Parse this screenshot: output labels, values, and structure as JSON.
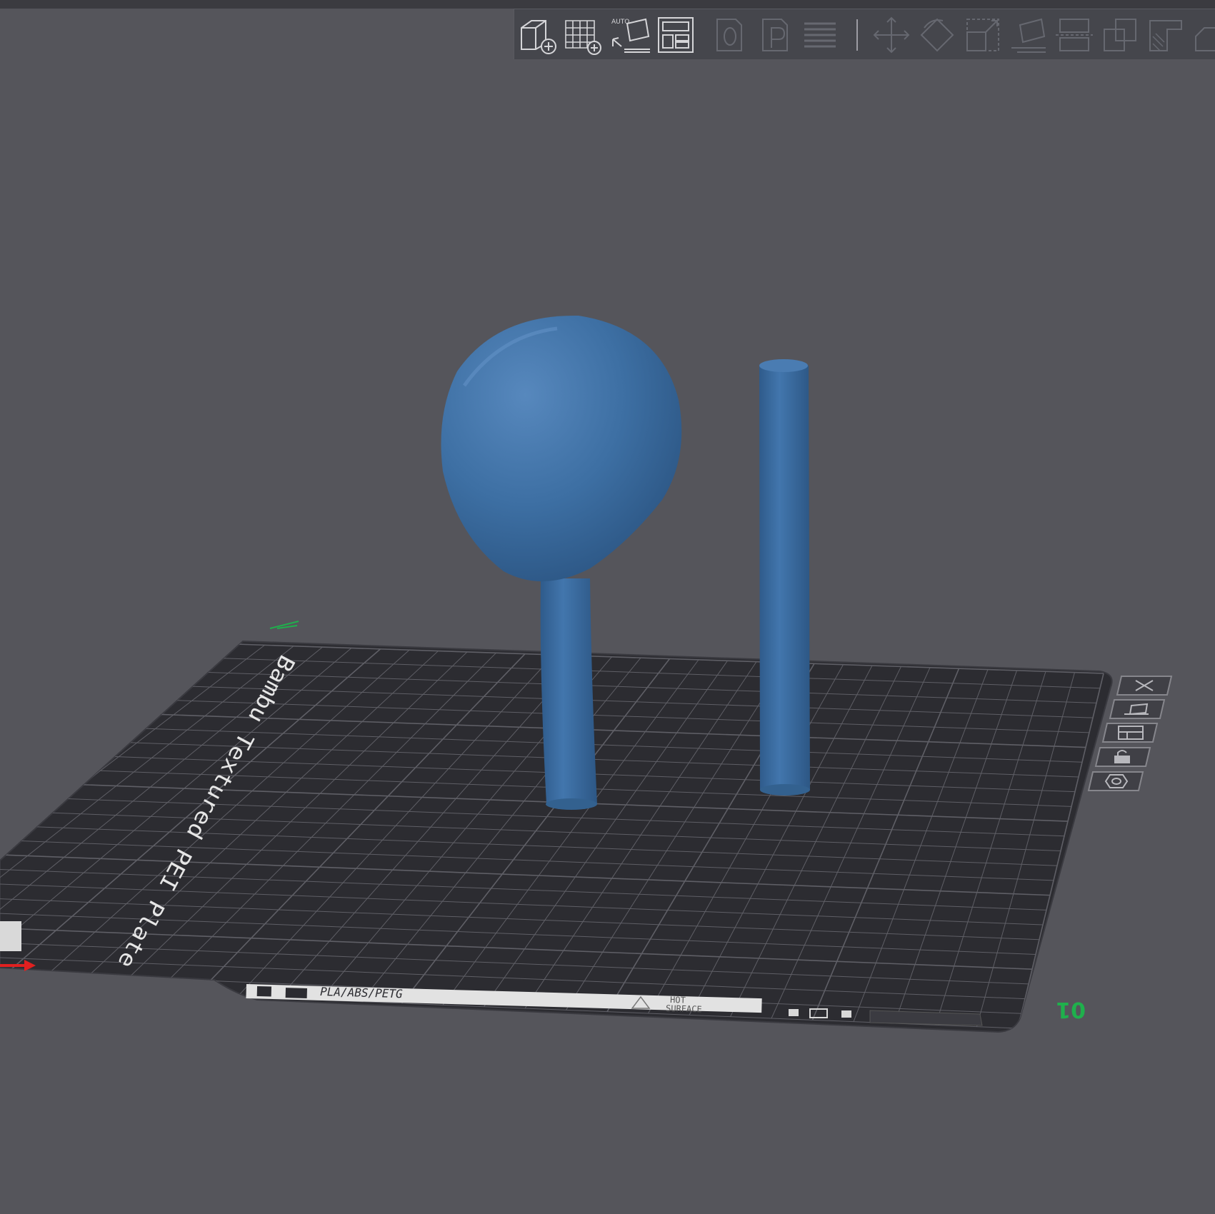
{
  "toolbar": {
    "items": [
      {
        "name": "add-object-icon",
        "enabled": true
      },
      {
        "name": "add-plate-icon",
        "enabled": true
      },
      {
        "name": "auto-orient-icon",
        "enabled": true,
        "label": "AUTO"
      },
      {
        "name": "arrange-icon",
        "enabled": true
      },
      {
        "name": "split-to-objects-icon",
        "enabled": false
      },
      {
        "name": "split-to-parts-icon",
        "enabled": false
      },
      {
        "name": "variable-layer-height-icon",
        "enabled": false
      },
      {
        "name": "move-icon",
        "enabled": false
      },
      {
        "name": "rotate-icon",
        "enabled": false
      },
      {
        "name": "scale-icon",
        "enabled": false
      },
      {
        "name": "lay-on-face-icon",
        "enabled": false
      },
      {
        "name": "cut-icon",
        "enabled": false
      },
      {
        "name": "boolean-icon",
        "enabled": false
      },
      {
        "name": "support-painting-icon",
        "enabled": false
      }
    ]
  },
  "plate": {
    "name_text": "Bambu Textured PEI Plate",
    "material_text": "PLA/ABS/PETG",
    "warning_text": [
      "HOT",
      "SURFACE"
    ],
    "plate_number": "01",
    "colors": {
      "plate": "#2c2c31",
      "grid": "#5f5f66",
      "text": "#e6e6e6",
      "number": "#1fb04c"
    }
  },
  "plate_buttons": [
    {
      "name": "delete-plate-button",
      "icon": "close-icon"
    },
    {
      "name": "auto-orient-plate-button",
      "icon": "auto-orient-icon"
    },
    {
      "name": "arrange-plate-button",
      "icon": "arrange-icon"
    },
    {
      "name": "lock-plate-button",
      "icon": "lock-icon"
    },
    {
      "name": "plate-settings-button",
      "icon": "settings-icon"
    }
  ],
  "objects": [
    {
      "name": "balloon-model",
      "color": "#3d6fa3"
    },
    {
      "name": "rod-model",
      "color": "#3d6fa3"
    }
  ],
  "axes": {
    "x_color": "#e02020",
    "y_color": "#1fb04c"
  }
}
